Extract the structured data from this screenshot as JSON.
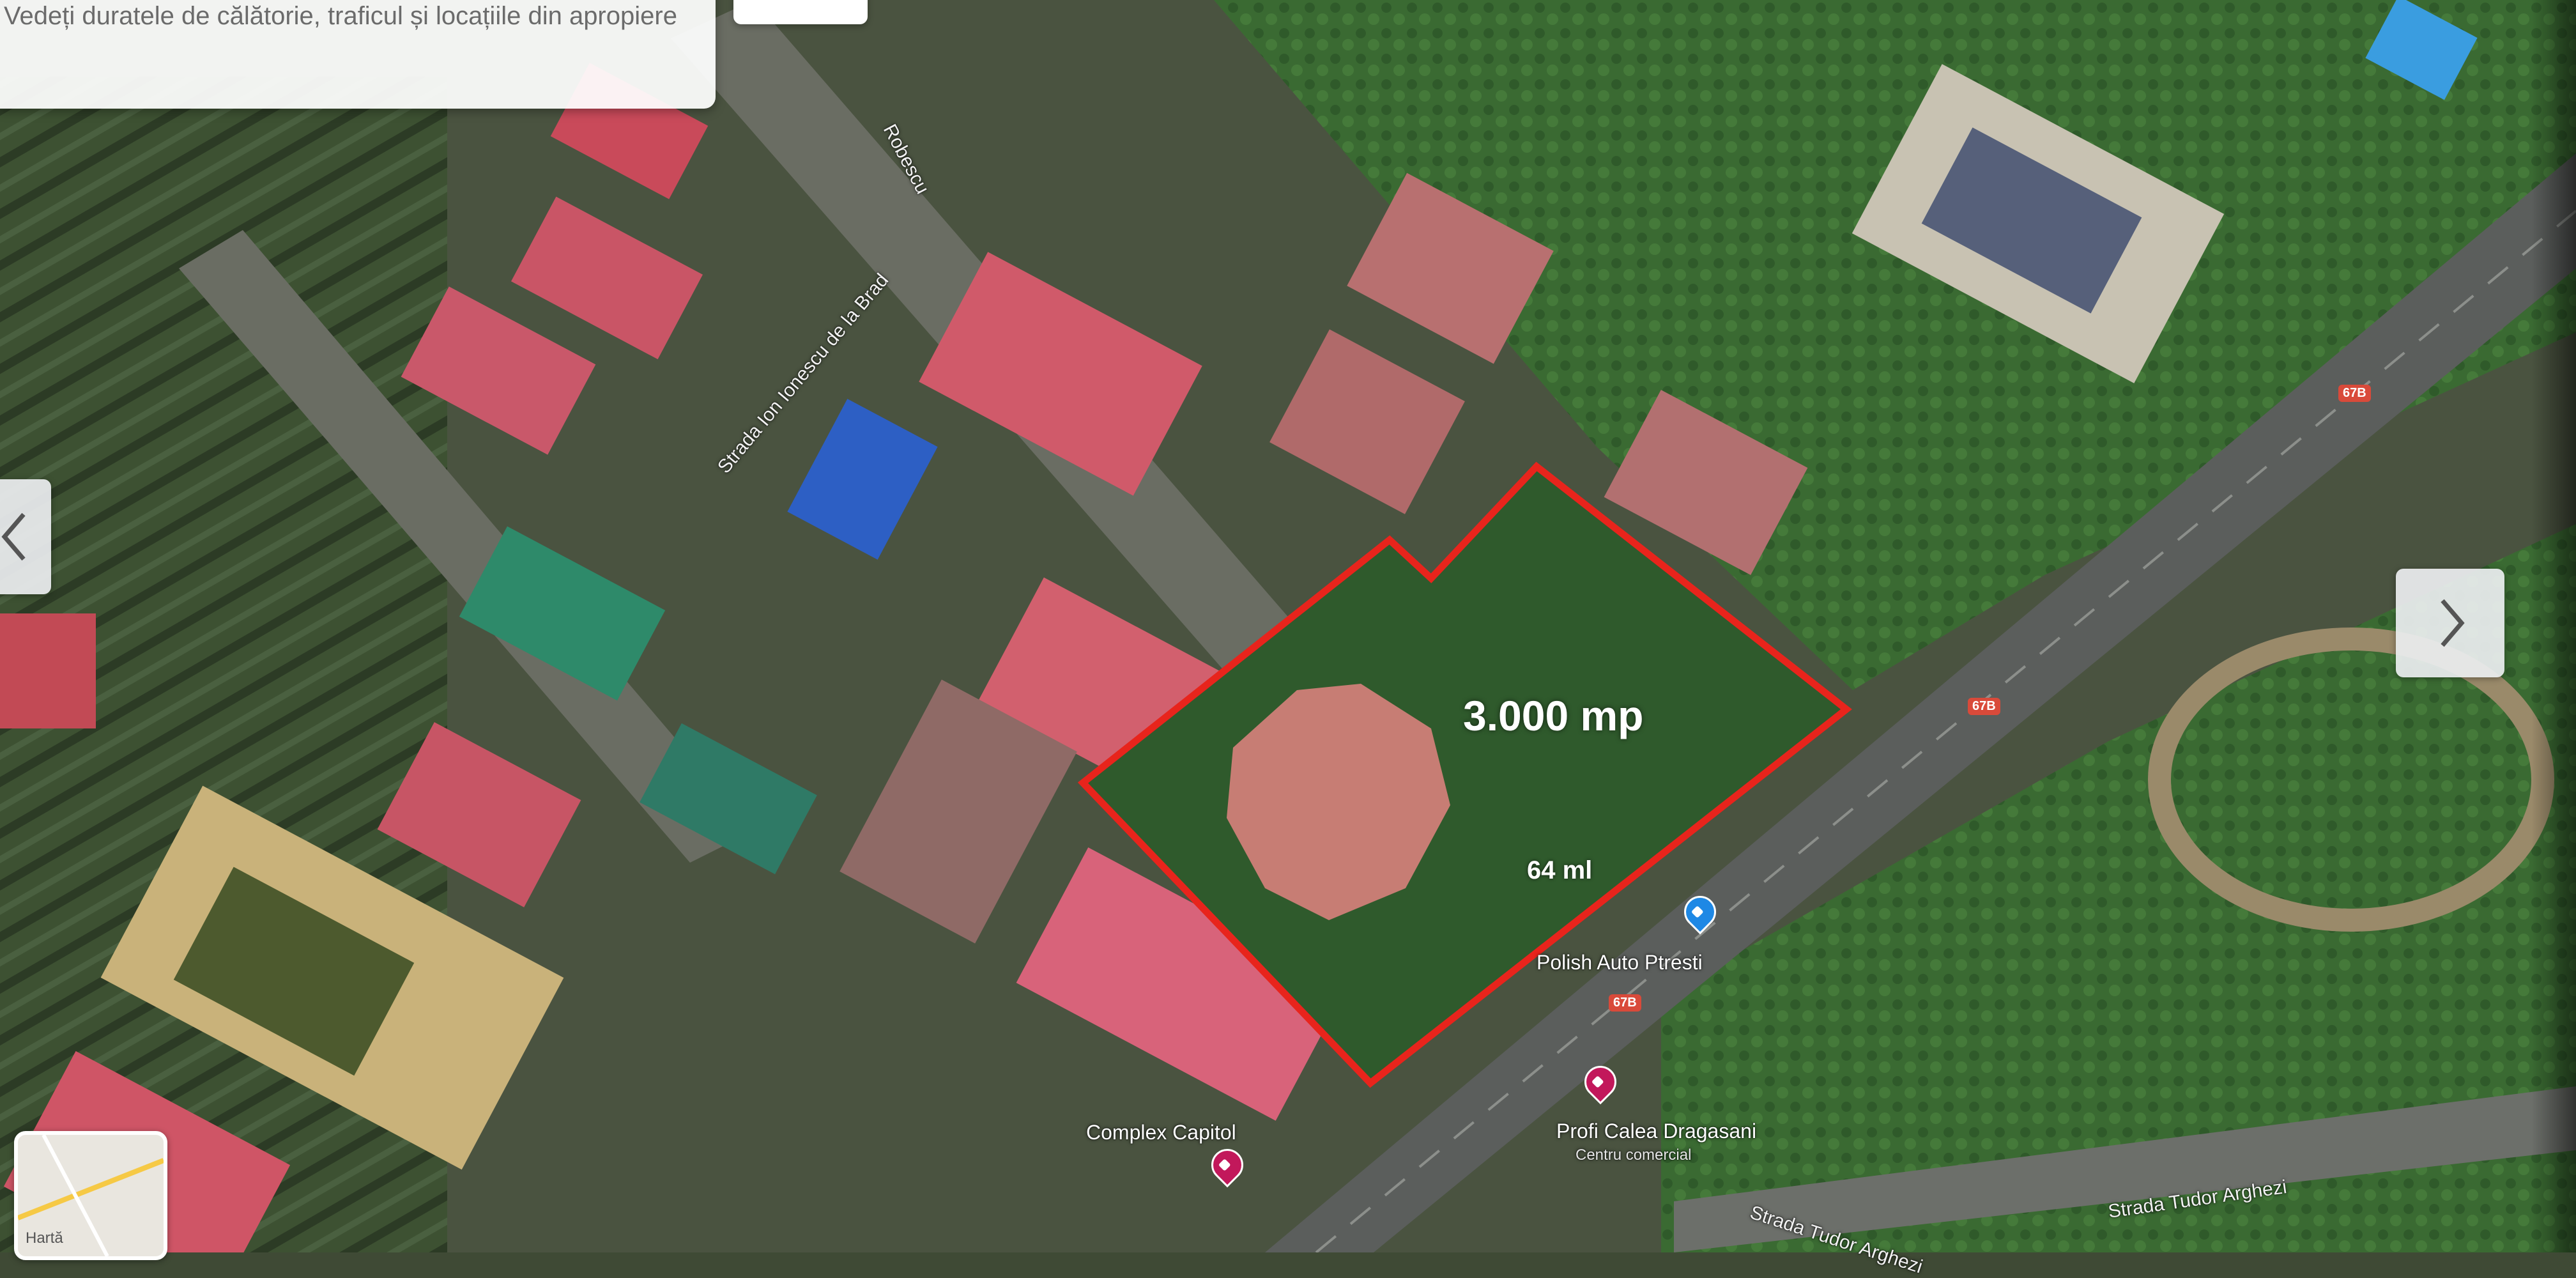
{
  "info_card": {
    "text": "Vedeți duratele de călătorie, traficul și locațiile din apropiere"
  },
  "parcel": {
    "area_label": "3.000 mp",
    "frontage_label": "64 ml",
    "outline_color": "#e8241c"
  },
  "roads": {
    "ion_ionescu": "Strada Ion Ionescu de la Brad",
    "robescu": "Robescu",
    "tudor_arghezi_1": "Strada Tudor Arghezi",
    "tudor_arghezi_2": "Strada Tudor Arghezi"
  },
  "route_badges": [
    "67B",
    "67B",
    "67B"
  ],
  "pois": {
    "polish_auto": "Polish Auto Ptresti",
    "profi": "Profi Calea Dragasani",
    "profi_sub": "Centru comercial",
    "complex": "Complex Capitol"
  },
  "icons": {
    "prev": "chevron-left-icon",
    "next": "chevron-right-icon",
    "pin": "shopping-pin-icon"
  },
  "map_toggle": {
    "label": "Hartă"
  }
}
